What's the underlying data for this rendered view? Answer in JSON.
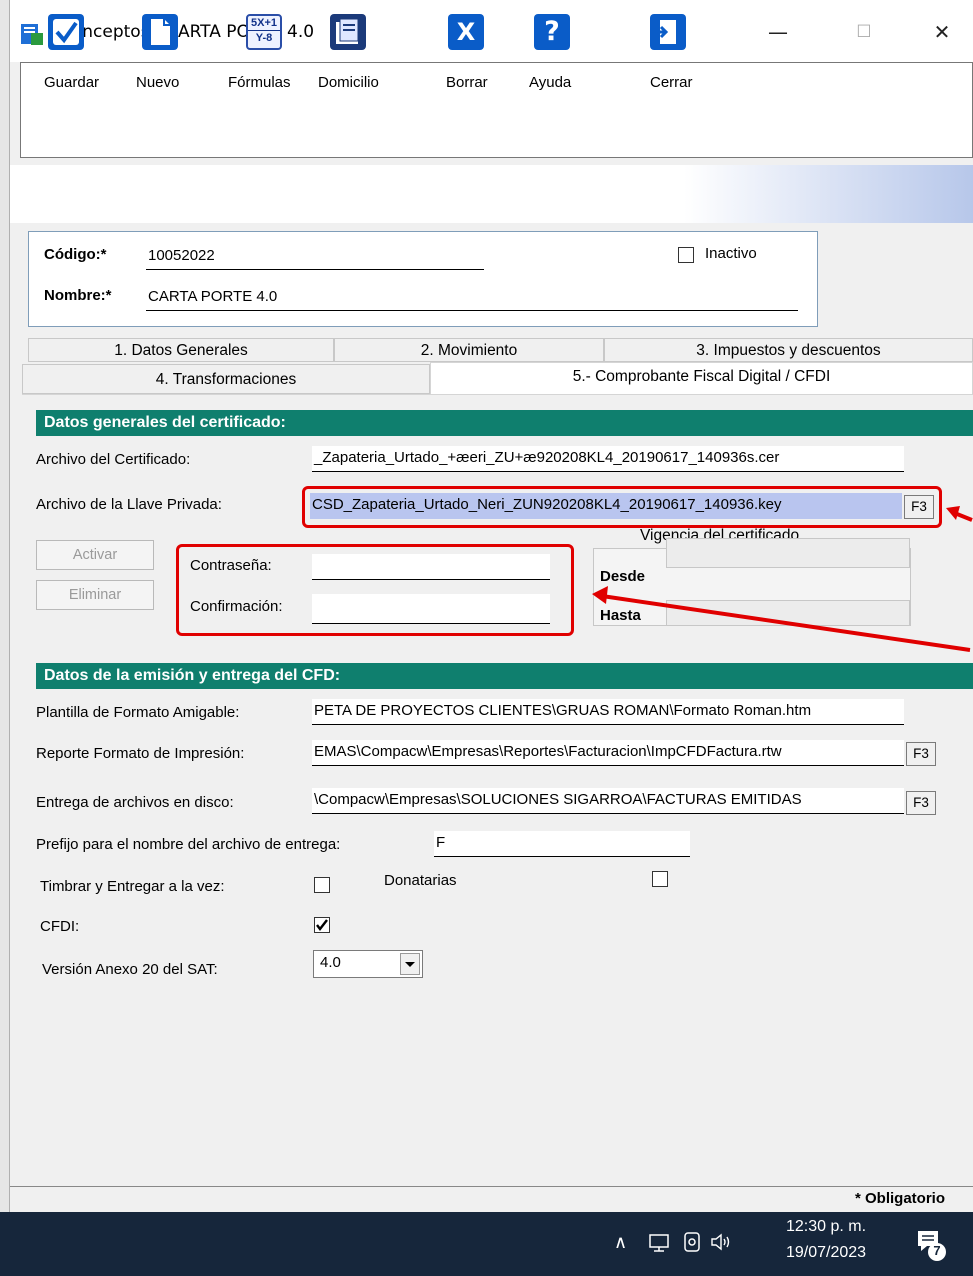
{
  "window": {
    "title": "Conceptos / CARTA PORTE 4.0",
    "minimize": "—",
    "maximize": "☐",
    "close": "✕"
  },
  "toolbar": {
    "items": [
      {
        "label": "Guardar",
        "icon": "check-icon"
      },
      {
        "label": "Nuevo",
        "icon": "new-document-icon"
      },
      {
        "label": "Fórmulas",
        "icon": "formula-icon"
      },
      {
        "label": "Domicilio",
        "icon": "address-book-icon"
      },
      {
        "label": "Borrar",
        "icon": "delete-x-icon"
      },
      {
        "label": "Ayuda",
        "icon": "help-icon"
      },
      {
        "label": "Cerrar",
        "icon": "exit-door-icon"
      }
    ],
    "formula_icon_text_top": "5X+1",
    "formula_icon_text_bottom": "Y-8",
    "delete_icon_glyph": "X",
    "help_icon_glyph": "?"
  },
  "header": {
    "codigo_label": "Código:*",
    "codigo_value": "10052022",
    "nombre_label": "Nombre:*",
    "nombre_value": "CARTA PORTE 4.0",
    "inactivo_label": "Inactivo",
    "inactivo_checked": false
  },
  "tabs": [
    {
      "label": "1. Datos Generales"
    },
    {
      "label": "2. Movimiento"
    },
    {
      "label": "3. Impuestos y descuentos"
    },
    {
      "label": "4. Transformaciones"
    },
    {
      "label": "5.- Comprobante Fiscal Digital / CFDI",
      "selected": true
    }
  ],
  "cert": {
    "section_title": "Datos generales del certificado:",
    "archivo_cert_label": "Archivo del Certificado:",
    "archivo_cert_value": "_Zapateria_Urtado_+æeri_ZU+æ920208KL4_20190617_140936s.cer",
    "llave_label": "Archivo de la Llave Privada:",
    "llave_value": "CSD_Zapateria_Urtado_Neri_ZUN920208KL4_20190617_140936.key",
    "f3": "F3",
    "vigencia_label": "Vigencia del certificado",
    "activar_label": "Activar",
    "eliminar_label": "Eliminar",
    "contrasena_label": "Contraseña:",
    "confirmacion_label": "Confirmación:",
    "desde_label": "Desde",
    "hasta_label": "Hasta"
  },
  "cfd": {
    "section_title": "Datos de la emisión y entrega del CFD:",
    "plantilla_label": "Plantilla de Formato Amigable:",
    "plantilla_value": "PETA DE PROYECTOS CLIENTES\\GRUAS ROMAN\\Formato Roman.htm",
    "reporte_label": "Reporte Formato de Impresión:",
    "reporte_value": "EMAS\\Compacw\\Empresas\\Reportes\\Facturacion\\ImpCFDFactura.rtw",
    "entrega_label": "Entrega de archivos en disco:",
    "entrega_value": "\\Compacw\\Empresas\\SOLUCIONES SIGARROA\\FACTURAS EMITIDAS",
    "f3": "F3",
    "prefijo_label": "Prefijo para el nombre del archivo de entrega:",
    "prefijo_value": "F",
    "timbrar_label": "Timbrar y Entregar a la vez:",
    "timbrar_checked": false,
    "donatarias_label": "Donatarias",
    "donatarias_checked": false,
    "cfdi_label": "CFDI:",
    "cfdi_checked": true,
    "version_label": "Versión Anexo 20 del SAT:",
    "version_value": "4.0"
  },
  "status": {
    "obligatorio": "* Obligatorio"
  },
  "taskbar": {
    "time": "12:30 p. m.",
    "date": "19/07/2023",
    "notification_count": "7"
  }
}
